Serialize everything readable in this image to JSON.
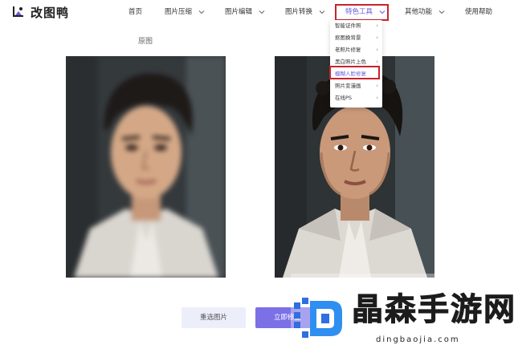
{
  "app": {
    "logo_text": "改图鸭"
  },
  "nav": {
    "items": [
      {
        "label": "首页"
      },
      {
        "label": "图片压缩"
      },
      {
        "label": "图片编辑"
      },
      {
        "label": "图片转换"
      },
      {
        "label": "特色工具"
      },
      {
        "label": "其他功能"
      },
      {
        "label": "使用帮助"
      }
    ],
    "active": "特色工具"
  },
  "panels": {
    "left_label": "原图"
  },
  "dropdown": {
    "items": [
      {
        "label": "智能证件照",
        "has_submenu": true
      },
      {
        "label": "抠图换背景",
        "has_submenu": true
      },
      {
        "label": "老照片修复",
        "has_submenu": true
      },
      {
        "label": "黑白照片上色",
        "has_submenu": true
      },
      {
        "label": "模糊人脸修复",
        "has_submenu": false,
        "selected": true
      },
      {
        "label": "照片变漫画",
        "has_submenu": true
      },
      {
        "label": "在线PS",
        "has_submenu": true
      }
    ]
  },
  "buttons": {
    "reselect": "重选图片",
    "fix": "立即修复"
  },
  "watermark": {
    "text": "晶森手游网",
    "url": "dingbaojia.com"
  },
  "colors": {
    "accent": "#6a5bd7",
    "highlight_border": "#c8232c",
    "primary_button": "#7b70e6",
    "secondary_button": "#eceefa"
  }
}
